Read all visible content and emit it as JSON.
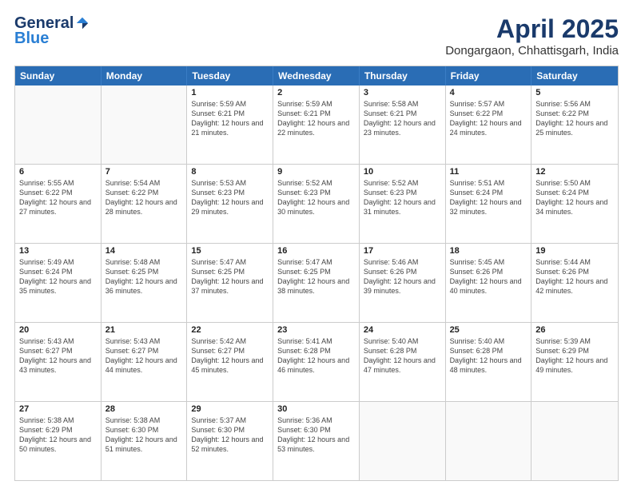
{
  "logo": {
    "general": "General",
    "blue": "Blue"
  },
  "header": {
    "month": "April 2025",
    "location": "Dongargaon, Chhattisgarh, India"
  },
  "weekdays": [
    "Sunday",
    "Monday",
    "Tuesday",
    "Wednesday",
    "Thursday",
    "Friday",
    "Saturday"
  ],
  "rows": [
    [
      {
        "day": "",
        "empty": true
      },
      {
        "day": "",
        "empty": true
      },
      {
        "day": "1",
        "sunrise": "Sunrise: 5:59 AM",
        "sunset": "Sunset: 6:21 PM",
        "daylight": "Daylight: 12 hours and 21 minutes."
      },
      {
        "day": "2",
        "sunrise": "Sunrise: 5:59 AM",
        "sunset": "Sunset: 6:21 PM",
        "daylight": "Daylight: 12 hours and 22 minutes."
      },
      {
        "day": "3",
        "sunrise": "Sunrise: 5:58 AM",
        "sunset": "Sunset: 6:21 PM",
        "daylight": "Daylight: 12 hours and 23 minutes."
      },
      {
        "day": "4",
        "sunrise": "Sunrise: 5:57 AM",
        "sunset": "Sunset: 6:22 PM",
        "daylight": "Daylight: 12 hours and 24 minutes."
      },
      {
        "day": "5",
        "sunrise": "Sunrise: 5:56 AM",
        "sunset": "Sunset: 6:22 PM",
        "daylight": "Daylight: 12 hours and 25 minutes."
      }
    ],
    [
      {
        "day": "6",
        "sunrise": "Sunrise: 5:55 AM",
        "sunset": "Sunset: 6:22 PM",
        "daylight": "Daylight: 12 hours and 27 minutes."
      },
      {
        "day": "7",
        "sunrise": "Sunrise: 5:54 AM",
        "sunset": "Sunset: 6:22 PM",
        "daylight": "Daylight: 12 hours and 28 minutes."
      },
      {
        "day": "8",
        "sunrise": "Sunrise: 5:53 AM",
        "sunset": "Sunset: 6:23 PM",
        "daylight": "Daylight: 12 hours and 29 minutes."
      },
      {
        "day": "9",
        "sunrise": "Sunrise: 5:52 AM",
        "sunset": "Sunset: 6:23 PM",
        "daylight": "Daylight: 12 hours and 30 minutes."
      },
      {
        "day": "10",
        "sunrise": "Sunrise: 5:52 AM",
        "sunset": "Sunset: 6:23 PM",
        "daylight": "Daylight: 12 hours and 31 minutes."
      },
      {
        "day": "11",
        "sunrise": "Sunrise: 5:51 AM",
        "sunset": "Sunset: 6:24 PM",
        "daylight": "Daylight: 12 hours and 32 minutes."
      },
      {
        "day": "12",
        "sunrise": "Sunrise: 5:50 AM",
        "sunset": "Sunset: 6:24 PM",
        "daylight": "Daylight: 12 hours and 34 minutes."
      }
    ],
    [
      {
        "day": "13",
        "sunrise": "Sunrise: 5:49 AM",
        "sunset": "Sunset: 6:24 PM",
        "daylight": "Daylight: 12 hours and 35 minutes."
      },
      {
        "day": "14",
        "sunrise": "Sunrise: 5:48 AM",
        "sunset": "Sunset: 6:25 PM",
        "daylight": "Daylight: 12 hours and 36 minutes."
      },
      {
        "day": "15",
        "sunrise": "Sunrise: 5:47 AM",
        "sunset": "Sunset: 6:25 PM",
        "daylight": "Daylight: 12 hours and 37 minutes."
      },
      {
        "day": "16",
        "sunrise": "Sunrise: 5:47 AM",
        "sunset": "Sunset: 6:25 PM",
        "daylight": "Daylight: 12 hours and 38 minutes."
      },
      {
        "day": "17",
        "sunrise": "Sunrise: 5:46 AM",
        "sunset": "Sunset: 6:26 PM",
        "daylight": "Daylight: 12 hours and 39 minutes."
      },
      {
        "day": "18",
        "sunrise": "Sunrise: 5:45 AM",
        "sunset": "Sunset: 6:26 PM",
        "daylight": "Daylight: 12 hours and 40 minutes."
      },
      {
        "day": "19",
        "sunrise": "Sunrise: 5:44 AM",
        "sunset": "Sunset: 6:26 PM",
        "daylight": "Daylight: 12 hours and 42 minutes."
      }
    ],
    [
      {
        "day": "20",
        "sunrise": "Sunrise: 5:43 AM",
        "sunset": "Sunset: 6:27 PM",
        "daylight": "Daylight: 12 hours and 43 minutes."
      },
      {
        "day": "21",
        "sunrise": "Sunrise: 5:43 AM",
        "sunset": "Sunset: 6:27 PM",
        "daylight": "Daylight: 12 hours and 44 minutes."
      },
      {
        "day": "22",
        "sunrise": "Sunrise: 5:42 AM",
        "sunset": "Sunset: 6:27 PM",
        "daylight": "Daylight: 12 hours and 45 minutes."
      },
      {
        "day": "23",
        "sunrise": "Sunrise: 5:41 AM",
        "sunset": "Sunset: 6:28 PM",
        "daylight": "Daylight: 12 hours and 46 minutes."
      },
      {
        "day": "24",
        "sunrise": "Sunrise: 5:40 AM",
        "sunset": "Sunset: 6:28 PM",
        "daylight": "Daylight: 12 hours and 47 minutes."
      },
      {
        "day": "25",
        "sunrise": "Sunrise: 5:40 AM",
        "sunset": "Sunset: 6:28 PM",
        "daylight": "Daylight: 12 hours and 48 minutes."
      },
      {
        "day": "26",
        "sunrise": "Sunrise: 5:39 AM",
        "sunset": "Sunset: 6:29 PM",
        "daylight": "Daylight: 12 hours and 49 minutes."
      }
    ],
    [
      {
        "day": "27",
        "sunrise": "Sunrise: 5:38 AM",
        "sunset": "Sunset: 6:29 PM",
        "daylight": "Daylight: 12 hours and 50 minutes."
      },
      {
        "day": "28",
        "sunrise": "Sunrise: 5:38 AM",
        "sunset": "Sunset: 6:30 PM",
        "daylight": "Daylight: 12 hours and 51 minutes."
      },
      {
        "day": "29",
        "sunrise": "Sunrise: 5:37 AM",
        "sunset": "Sunset: 6:30 PM",
        "daylight": "Daylight: 12 hours and 52 minutes."
      },
      {
        "day": "30",
        "sunrise": "Sunrise: 5:36 AM",
        "sunset": "Sunset: 6:30 PM",
        "daylight": "Daylight: 12 hours and 53 minutes."
      },
      {
        "day": "",
        "empty": true
      },
      {
        "day": "",
        "empty": true
      },
      {
        "day": "",
        "empty": true
      }
    ]
  ]
}
